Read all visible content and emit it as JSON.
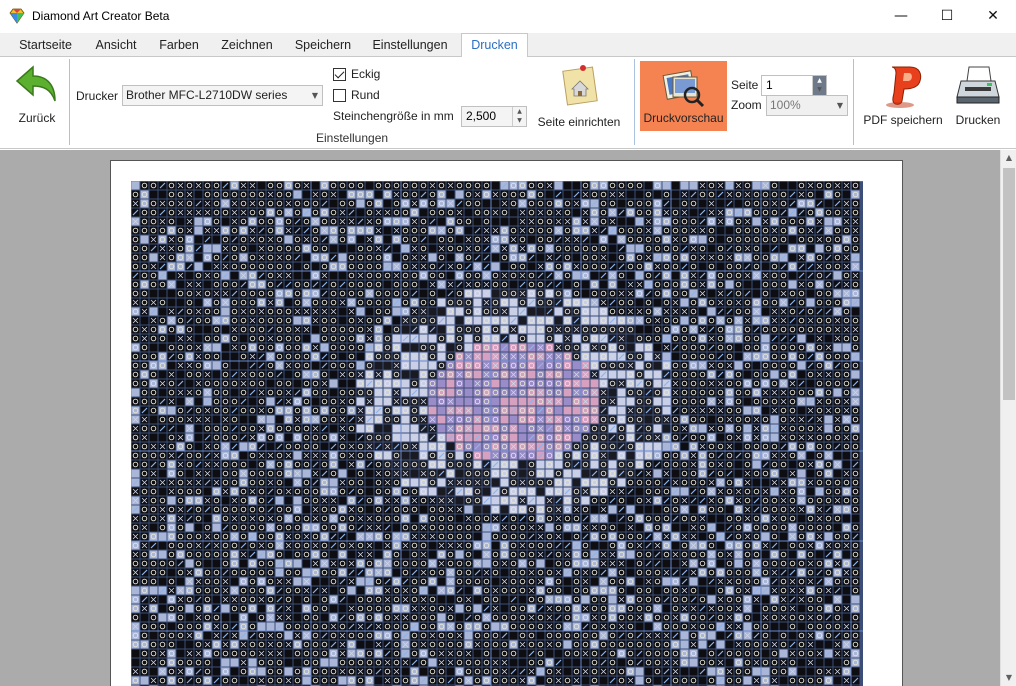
{
  "window": {
    "title": "Diamond Art Creator Beta",
    "minimize": "—",
    "maximize": "☐",
    "close": "✕"
  },
  "tabs": [
    {
      "label": "Startseite"
    },
    {
      "label": "Ansicht"
    },
    {
      "label": "Farben"
    },
    {
      "label": "Zeichnen"
    },
    {
      "label": "Speichern"
    },
    {
      "label": "Einstellungen"
    },
    {
      "label": "Drucken",
      "active": true
    }
  ],
  "ribbon": {
    "back_label": "Zurück",
    "printer_label": "Drucker",
    "printer_value": "Brother MFC-L2710DW series",
    "option_square": "Eckig",
    "option_square_checked": true,
    "option_round": "Rund",
    "option_round_checked": false,
    "stone_size_label": "Steinchengröße in mm",
    "stone_size_value": "2,500",
    "page_setup_label": "Seite einrichten",
    "group_settings": "Einstellungen",
    "preview_label": "Druckvorschau",
    "page_label": "Seite",
    "page_value": "1",
    "zoom_label": "Zoom",
    "zoom_value": "100%",
    "pdf_label": "PDF speichern",
    "print_label": "Drucken"
  },
  "colors": {
    "accent": "#2b6fc2",
    "preview_active": "#f58352",
    "ribbon_separator": "#a8c2e0"
  }
}
